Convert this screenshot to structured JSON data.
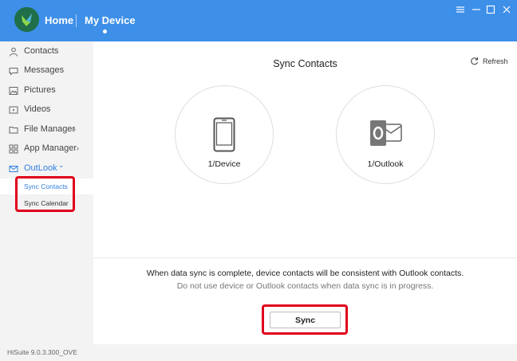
{
  "header": {
    "home_label": "Home",
    "device_label": "My Device",
    "bg_color": "#3d8fe8"
  },
  "sidebar": {
    "items": [
      {
        "label": "Contacts",
        "icon": "person-icon"
      },
      {
        "label": "Messages",
        "icon": "chat-bubble-icon"
      },
      {
        "label": "Pictures",
        "icon": "image-icon"
      },
      {
        "label": "Videos",
        "icon": "video-icon"
      },
      {
        "label": "File Manager",
        "icon": "folder-icon",
        "chevron": "›"
      },
      {
        "label": "App Manager",
        "icon": "grid-icon",
        "chevron": "›"
      },
      {
        "label": "OutLook",
        "icon": "mail-icon",
        "chevron": "⌄"
      }
    ],
    "sub_items": [
      {
        "label": "Sync Contacts"
      },
      {
        "label": "Sync Calendar"
      }
    ],
    "active_color": "#2f7fe0"
  },
  "main": {
    "title": "Sync Contacts",
    "refresh_label": "Refresh",
    "device_circle_label": "1/Device",
    "outlook_circle_label": "1/Outlook",
    "info_line1": "When data sync is complete, device contacts will be consistent with Outlook contacts.",
    "info_line2": "Do not use device or Outlook contacts when data sync is in progress.",
    "sync_button_label": "Sync",
    "highlight_color": "#e0001b"
  },
  "footer": {
    "version": "HiSuite 9.0.3.300_OVE"
  }
}
